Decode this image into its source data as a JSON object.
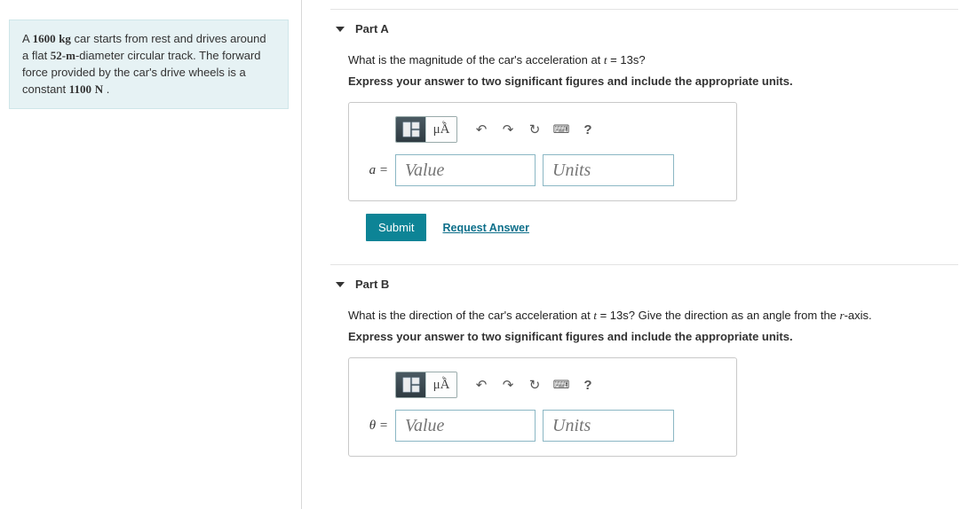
{
  "problem": {
    "mass": "1600",
    "mass_unit": "kg",
    "t1": " car starts from rest and drives around a flat ",
    "diameter": "52-m",
    "t2": "-diameter circular track. The forward force provided by the car's drive wheels is a constant ",
    "force": "1100",
    "force_unit": "N",
    "tail": " ."
  },
  "parts": {
    "a": {
      "title": "Part A",
      "q_pre": "What is the magnitude of the car's acceleration at ",
      "q_var": "t",
      "q_eq": " = ",
      "q_val": "13s",
      "q_post": "?",
      "instr": "Express your answer to two significant figures and include the appropriate units.",
      "var_label": "a =",
      "value_ph": "Value",
      "units_ph": "Units",
      "submit": "Submit",
      "request": "Request Answer"
    },
    "b": {
      "title": "Part B",
      "q_pre": "What is the direction of the car's acceleration at ",
      "q_var": "t",
      "q_eq": " = ",
      "q_val": "13s",
      "q_post": "? Give the direction as an angle from the ",
      "q_axis": "r",
      "q_post2": "-axis.",
      "instr": "Express your answer to two significant figures and include the appropriate units.",
      "var_label": "θ =",
      "value_ph": "Value",
      "units_ph": "Units"
    }
  },
  "toolbar": {
    "template": "template-icon",
    "units_btn": "μÅ",
    "undo": "↶",
    "redo": "↷",
    "reset": "↻",
    "keyboard": "⌨",
    "help": "?"
  }
}
